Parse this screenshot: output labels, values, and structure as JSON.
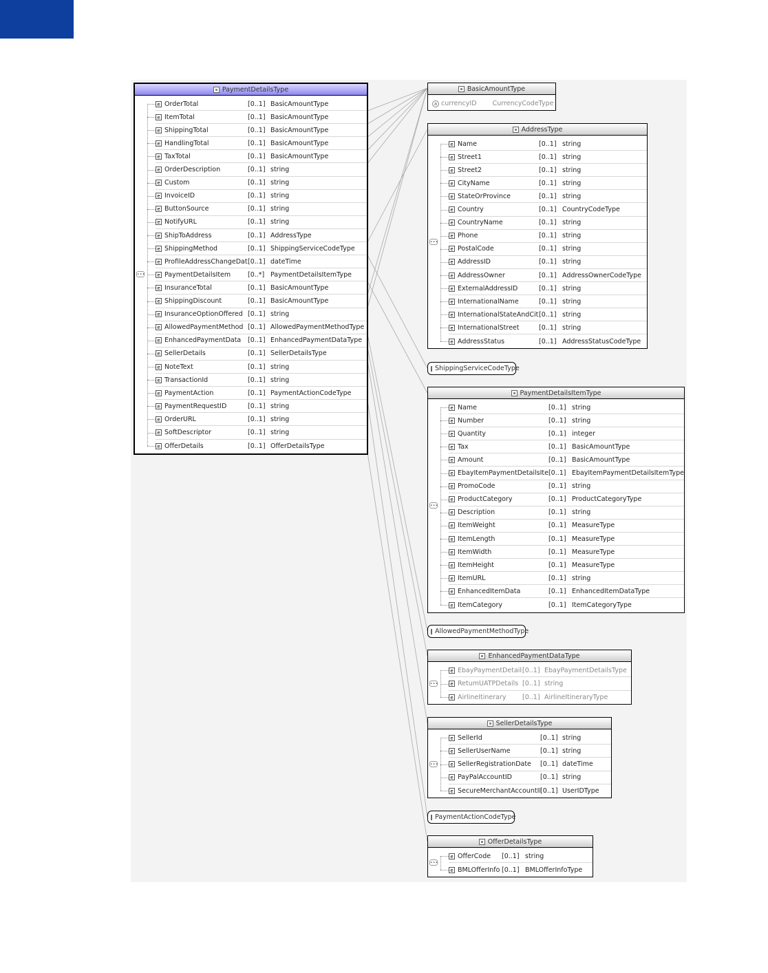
{
  "diagram": {
    "main": {
      "title": "PaymentDetailsType",
      "rows": [
        {
          "name": "OrderTotal",
          "card": "[0..1]",
          "type": "BasicAmountType"
        },
        {
          "name": "ItemTotal",
          "card": "[0..1]",
          "type": "BasicAmountType"
        },
        {
          "name": "ShippingTotal",
          "card": "[0..1]",
          "type": "BasicAmountType"
        },
        {
          "name": "HandlingTotal",
          "card": "[0..1]",
          "type": "BasicAmountType"
        },
        {
          "name": "TaxTotal",
          "card": "[0..1]",
          "type": "BasicAmountType"
        },
        {
          "name": "OrderDescription",
          "card": "[0..1]",
          "type": "string"
        },
        {
          "name": "Custom",
          "card": "[0..1]",
          "type": "string"
        },
        {
          "name": "InvoiceID",
          "card": "[0..1]",
          "type": "string"
        },
        {
          "name": "ButtonSource",
          "card": "[0..1]",
          "type": "string"
        },
        {
          "name": "NotifyURL",
          "card": "[0..1]",
          "type": "string"
        },
        {
          "name": "ShipToAddress",
          "card": "[0..1]",
          "type": "AddressType"
        },
        {
          "name": "ShippingMethod",
          "card": "[0..1]",
          "type": "ShippingServiceCodeType"
        },
        {
          "name": "ProfileAddressChangeDate",
          "card": "[0..1]",
          "type": "dateTime"
        },
        {
          "name": "PaymentDetailsItem",
          "card": "[0..*]",
          "type": "PaymentDetailsItemType"
        },
        {
          "name": "InsuranceTotal",
          "card": "[0..1]",
          "type": "BasicAmountType"
        },
        {
          "name": "ShippingDiscount",
          "card": "[0..1]",
          "type": "BasicAmountType"
        },
        {
          "name": "InsuranceOptionOffered",
          "card": "[0..1]",
          "type": "string"
        },
        {
          "name": "AllowedPaymentMethod",
          "card": "[0..1]",
          "type": "AllowedPaymentMethodType"
        },
        {
          "name": "EnhancedPaymentData",
          "card": "[0..1]",
          "type": "EnhancedPaymentDataType"
        },
        {
          "name": "SellerDetails",
          "card": "[0..1]",
          "type": "SellerDetailsType"
        },
        {
          "name": "NoteText",
          "card": "[0..1]",
          "type": "string"
        },
        {
          "name": "TransactionId",
          "card": "[0..1]",
          "type": "string"
        },
        {
          "name": "PaymentAction",
          "card": "[0..1]",
          "type": "PaymentActionCodeType"
        },
        {
          "name": "PaymentRequestID",
          "card": "[0..1]",
          "type": "string"
        },
        {
          "name": "OrderURL",
          "card": "[0..1]",
          "type": "string"
        },
        {
          "name": "SoftDescriptor",
          "card": "[0..1]",
          "type": "string"
        },
        {
          "name": "OfferDetails",
          "card": "[0..1]",
          "type": "OfferDetailsType"
        }
      ]
    },
    "basic_amount": {
      "title": "BasicAmountType",
      "attr_icon": "a",
      "attr": {
        "name": "currencyID",
        "type": "CurrencyCodeType"
      }
    },
    "address": {
      "title": "AddressType",
      "rows": [
        {
          "name": "Name",
          "card": "[0..1]",
          "type": "string"
        },
        {
          "name": "Street1",
          "card": "[0..1]",
          "type": "string"
        },
        {
          "name": "Street2",
          "card": "[0..1]",
          "type": "string"
        },
        {
          "name": "CityName",
          "card": "[0..1]",
          "type": "string"
        },
        {
          "name": "StateOrProvince",
          "card": "[0..1]",
          "type": "string"
        },
        {
          "name": "Country",
          "card": "[0..1]",
          "type": "CountryCodeType"
        },
        {
          "name": "CountryName",
          "card": "[0..1]",
          "type": "string"
        },
        {
          "name": "Phone",
          "card": "[0..1]",
          "type": "string"
        },
        {
          "name": "PostalCode",
          "card": "[0..1]",
          "type": "string"
        },
        {
          "name": "AddressID",
          "card": "[0..1]",
          "type": "string"
        },
        {
          "name": "AddressOwner",
          "card": "[0..1]",
          "type": "AddressOwnerCodeType"
        },
        {
          "name": "ExternalAddressID",
          "card": "[0..1]",
          "type": "string"
        },
        {
          "name": "InternationalName",
          "card": "[0..1]",
          "type": "string"
        },
        {
          "name": "InternationalStateAndCity",
          "card": "[0..1]",
          "type": "string"
        },
        {
          "name": "InternationalStreet",
          "card": "[0..1]",
          "type": "string"
        },
        {
          "name": "AddressStatus",
          "card": "[0..1]",
          "type": "AddressStatusCodeType"
        }
      ]
    },
    "shipping_service": {
      "title": "ShippingServiceCodeType"
    },
    "item": {
      "title": "PaymentDetailsItemType",
      "rows": [
        {
          "name": "Name",
          "card": "[0..1]",
          "type": "string"
        },
        {
          "name": "Number",
          "card": "[0..1]",
          "type": "string"
        },
        {
          "name": "Quantity",
          "card": "[0..1]",
          "type": "integer"
        },
        {
          "name": "Tax",
          "card": "[0..1]",
          "type": "BasicAmountType"
        },
        {
          "name": "Amount",
          "card": "[0..1]",
          "type": "BasicAmountType"
        },
        {
          "name": "EbayItemPaymentDetailsItem",
          "card": "[0..1]",
          "type": "EbayItemPaymentDetailsItemType"
        },
        {
          "name": "PromoCode",
          "card": "[0..1]",
          "type": "string"
        },
        {
          "name": "ProductCategory",
          "card": "[0..1]",
          "type": "ProductCategoryType"
        },
        {
          "name": "Description",
          "card": "[0..1]",
          "type": "string"
        },
        {
          "name": "ItemWeight",
          "card": "[0..1]",
          "type": "MeasureType"
        },
        {
          "name": "ItemLength",
          "card": "[0..1]",
          "type": "MeasureType"
        },
        {
          "name": "ItemWidth",
          "card": "[0..1]",
          "type": "MeasureType"
        },
        {
          "name": "ItemHeight",
          "card": "[0..1]",
          "type": "MeasureType"
        },
        {
          "name": "ItemURL",
          "card": "[0..1]",
          "type": "string"
        },
        {
          "name": "EnhancedItemData",
          "card": "[0..1]",
          "type": "EnhancedItemDataType"
        },
        {
          "name": "ItemCategory",
          "card": "[0..1]",
          "type": "ItemCategoryType"
        }
      ]
    },
    "allowed": {
      "title": "AllowedPaymentMethodType"
    },
    "enhanced": {
      "title": "EnhancedPaymentDataType",
      "rows": [
        {
          "name": "EbayPaymentDetails",
          "card": "[0..1]",
          "type": "EbayPaymentDetailsType"
        },
        {
          "name": "RetumUATPDetails",
          "card": "[0..1]",
          "type": "string"
        },
        {
          "name": "AirlineItinerary",
          "card": "[0..1]",
          "type": "AirlineItineraryType"
        }
      ]
    },
    "seller": {
      "title": "SellerDetailsType",
      "rows": [
        {
          "name": "SellerId",
          "card": "[0..1]",
          "type": "string"
        },
        {
          "name": "SellerUserName",
          "card": "[0..1]",
          "type": "string"
        },
        {
          "name": "SellerRegistrationDate",
          "card": "[0..1]",
          "type": "dateTime"
        },
        {
          "name": "PayPalAccountID",
          "card": "[0..1]",
          "type": "string"
        },
        {
          "name": "SecureMerchantAccountID",
          "card": "[0..1]",
          "type": "UserIDType"
        }
      ]
    },
    "payment_action": {
      "title": "PaymentActionCodeType"
    },
    "offer": {
      "title": "OfferDetailsType",
      "rows": [
        {
          "name": "OfferCode",
          "card": "[0..1]",
          "type": "string"
        },
        {
          "name": "BMLOfferInfo",
          "card": "[0..1]",
          "type": "BMLOfferInfoType"
        }
      ]
    }
  },
  "element_icon": "e",
  "sequence_icon": "∙∙∙",
  "colors": {
    "corner": "#0e3e9e",
    "main_header": "#8f88f0",
    "canvas": "#f3f3f3"
  }
}
